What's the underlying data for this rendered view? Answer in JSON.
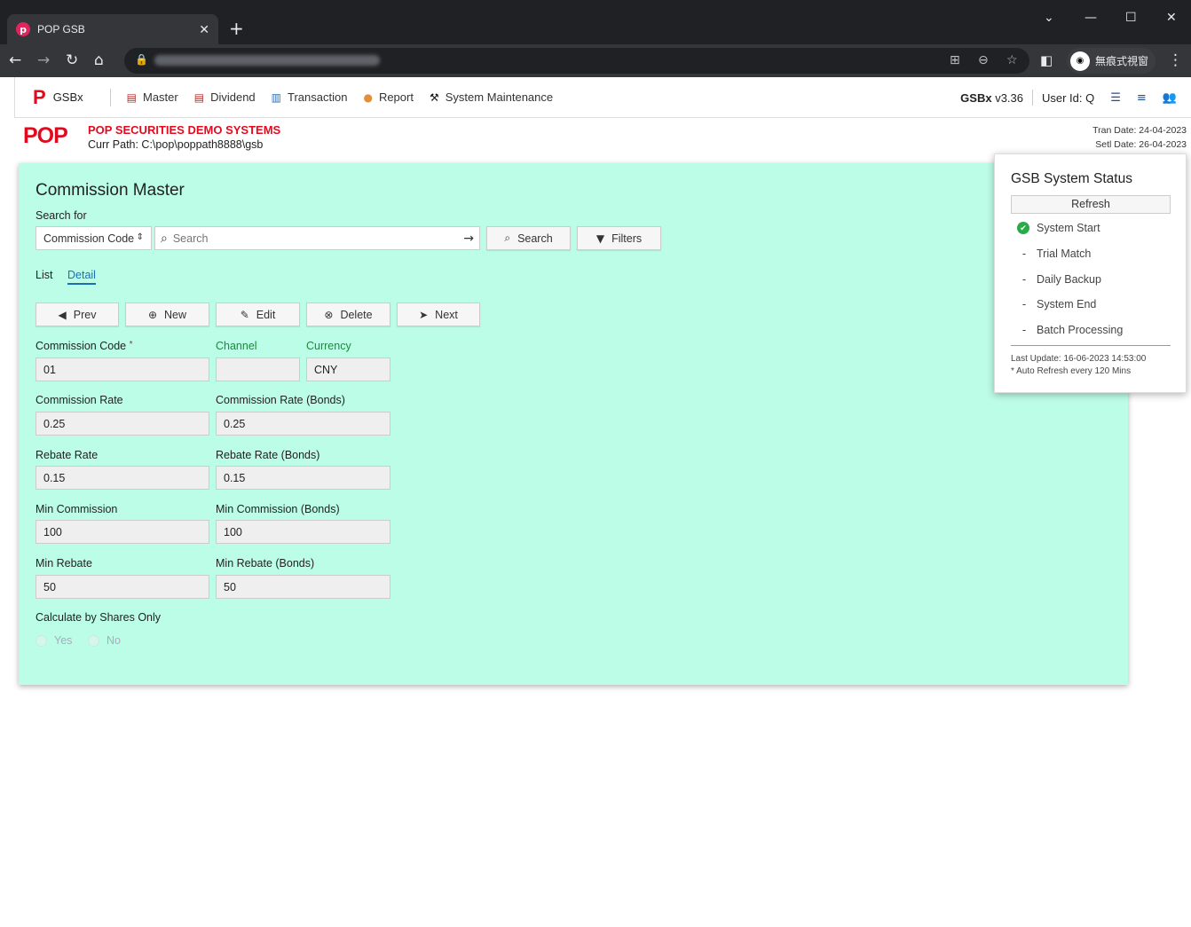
{
  "browser": {
    "tab_title": "POP GSB",
    "favicon_letter": "p",
    "incognito_label": "無痕式視窗"
  },
  "nav": {
    "brand": "GSBx",
    "menu": [
      "Master",
      "Dividend",
      "Transaction",
      "Report",
      "System Maintenance"
    ],
    "version_bold": "GSBx",
    "version": "v3.36",
    "user": "User Id: Q"
  },
  "header": {
    "logo": "POP",
    "system_name": "POP SECURITIES DEMO SYSTEMS",
    "curr_path": "Curr Path: C:\\pop\\poppath8888\\gsb",
    "tran_date": "Tran Date: 24-04-2023",
    "setl_date": "Setl Date: 26-04-2023"
  },
  "main": {
    "title": "Commission Master",
    "search_for": "Search for",
    "select_value": "Commission Code",
    "search_placeholder": "Search",
    "search_button": "Search",
    "filters_button": "Filters",
    "tabs": [
      "List",
      "Detail"
    ],
    "actions": [
      "Prev",
      "New",
      "Edit",
      "Delete",
      "Next"
    ],
    "fields": {
      "commission_code": {
        "label": "Commission Code",
        "value": "01"
      },
      "channel": {
        "label": "Channel",
        "value": ""
      },
      "currency": {
        "label": "Currency",
        "value": "CNY"
      },
      "commission_rate": {
        "label": "Commission Rate",
        "value": "0.25"
      },
      "commission_rate_bonds": {
        "label": "Commission Rate (Bonds)",
        "value": "0.25"
      },
      "rebate_rate": {
        "label": "Rebate Rate",
        "value": "0.15"
      },
      "rebate_rate_bonds": {
        "label": "Rebate Rate (Bonds)",
        "value": "0.15"
      },
      "min_commission": {
        "label": "Min Commission",
        "value": "100"
      },
      "min_commission_bonds": {
        "label": "Min Commission (Bonds)",
        "value": "100"
      },
      "min_rebate": {
        "label": "Min Rebate",
        "value": "50"
      },
      "min_rebate_bonds": {
        "label": "Min Rebate (Bonds)",
        "value": "50"
      }
    },
    "calc_label": "Calculate by Shares Only",
    "radio_yes": "Yes",
    "radio_no": "No"
  },
  "status": {
    "title": "GSB System Status",
    "refresh": "Refresh",
    "steps": [
      "System Start",
      "Trial Match",
      "Daily Backup",
      "System End",
      "Batch Processing"
    ],
    "last_update": "Last Update: 16-06-2023 14:53:00",
    "auto_refresh": "* Auto Refresh every 120 Mins"
  },
  "colors": {
    "panel_bg": "#bcfde8",
    "brand_red": "#e10b1f",
    "link_blue": "#1b6fb5",
    "ok_green": "#2aab4a"
  }
}
